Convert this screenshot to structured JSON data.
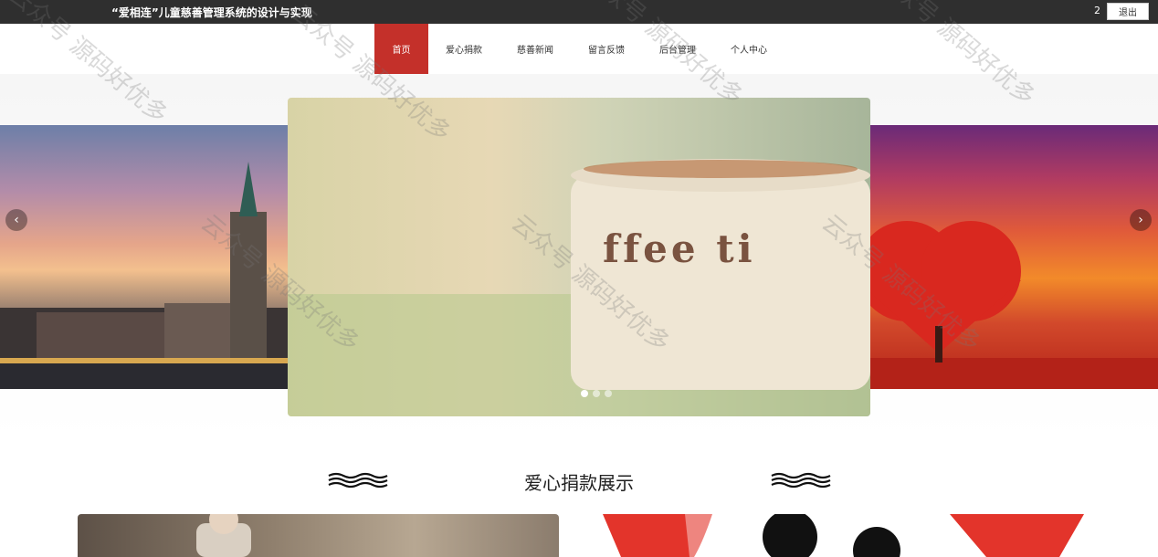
{
  "header": {
    "app_title": "“爱相连”儿童慈善管理系统的设计与实现",
    "user_count": "2",
    "logout_label": "退出"
  },
  "nav": {
    "items": [
      {
        "label": "首页",
        "active": true
      },
      {
        "label": "爱心捐款",
        "active": false
      },
      {
        "label": "慈善新闻",
        "active": false
      },
      {
        "label": "留言反馈",
        "active": false
      },
      {
        "label": "后台管理",
        "active": false
      },
      {
        "label": "个人中心",
        "active": false
      }
    ]
  },
  "carousel": {
    "slide_count": 3,
    "active_slide": 1,
    "main_slide_text": "ffee ti"
  },
  "section": {
    "title": "爱心捐款展示"
  },
  "watermark": {
    "text": "云众号 源码好优多"
  },
  "colors": {
    "topbar_bg": "#2f2f2f",
    "nav_active_bg": "#c4302a",
    "nav_text": "#333333"
  }
}
